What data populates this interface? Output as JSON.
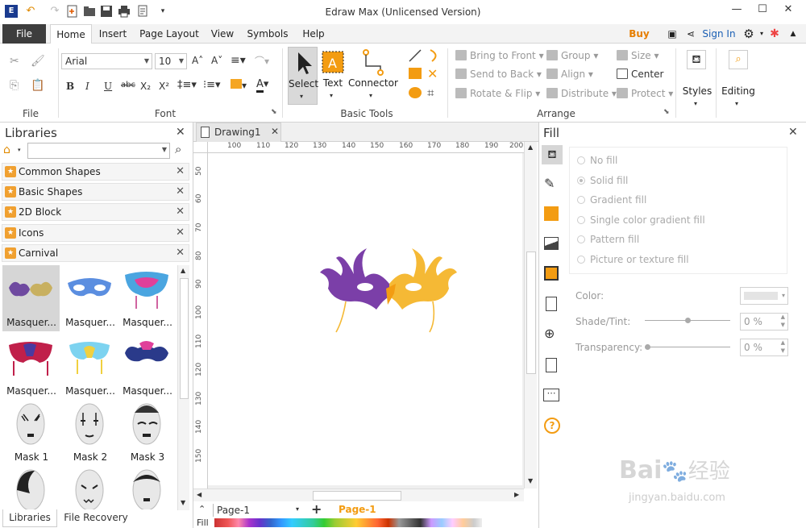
{
  "window": {
    "title": "Edraw Max (Unlicensed Version)",
    "minimize": "—",
    "maximize": "☐",
    "close": "✕"
  },
  "quick_access": [
    "app-logo-icon",
    "undo-icon",
    "redo-icon",
    "new-icon",
    "open-icon",
    "save-icon",
    "print-icon",
    "export-icon",
    "customize-icon"
  ],
  "tabs": {
    "file": "File",
    "items": [
      "Home",
      "Insert",
      "Page Layout",
      "View",
      "Symbols",
      "Help"
    ],
    "active": "Home",
    "buy_now": "Buy Now",
    "sign_in": "Sign In"
  },
  "ribbon": {
    "file_group": {
      "label": "File"
    },
    "font_group": {
      "label": "Font",
      "font_name": "Arial",
      "font_size": "10",
      "bold": "B",
      "italic": "I",
      "underline": "U",
      "strike": "abc",
      "subscript": "X₂",
      "superscript": "X²"
    },
    "basic_tools": {
      "label": "Basic Tools",
      "select": "Select",
      "text": "Text",
      "connector": "Connector"
    },
    "arrange": {
      "label": "Arrange",
      "bring_to_front": "Bring to Front",
      "send_to_back": "Send to Back",
      "rotate_flip": "Rotate & Flip",
      "group": "Group",
      "align": "Align",
      "distribute": "Distribute",
      "size": "Size",
      "center": "Center",
      "protect": "Protect"
    },
    "styles": "Styles",
    "editing": "Editing"
  },
  "libraries": {
    "title": "Libraries",
    "search_placeholder": "",
    "categories": [
      "Common Shapes",
      "Basic Shapes",
      "2D Block",
      "Icons",
      "Carnival"
    ],
    "shapes": [
      "Masquer...",
      "Masquer...",
      "Masquer...",
      "Masquer...",
      "Masquer...",
      "Masquer...",
      "Mask 1",
      "Mask 2",
      "Mask 3",
      "",
      "",
      ""
    ],
    "bottom_tabs": [
      "Libraries",
      "File Recovery"
    ]
  },
  "document": {
    "tab": "Drawing1",
    "ruler_h": [
      "100",
      "110",
      "120",
      "130",
      "140",
      "150",
      "160",
      "170",
      "180",
      "190",
      "200"
    ],
    "ruler_v": [
      "50",
      "60",
      "70",
      "80",
      "90",
      "100",
      "110",
      "120",
      "130",
      "140",
      "150"
    ],
    "page_selector": "Page-1",
    "active_page": "Page-1",
    "fill_label": "Fill"
  },
  "fill_panel": {
    "title": "Fill",
    "options": [
      "No fill",
      "Solid fill",
      "Gradient fill",
      "Single color gradient fill",
      "Pattern fill",
      "Picture or texture fill"
    ],
    "selected": "Solid fill",
    "color_label": "Color:",
    "shade_label": "Shade/Tint:",
    "shade_value": "0 %",
    "transparency_label": "Transparency:",
    "transparency_value": "0 %"
  },
  "colors": {
    "accent_orange": "#f39c12",
    "purple": "#7b3fa8",
    "gold": "#f5b935",
    "ribbon_sel": "#d4d4d4",
    "blue_link": "#1a5fb4"
  },
  "watermark": {
    "text1": "Bai",
    "text2": "经验",
    "url": "jingyan.baidu.com"
  }
}
